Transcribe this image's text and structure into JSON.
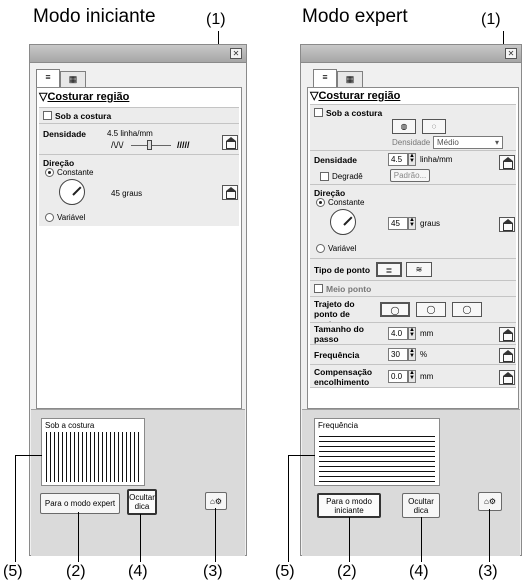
{
  "left": {
    "heading": "Modo iniciante",
    "section_title": "Costurar região",
    "sob_costura": "Sob a costura",
    "densidade_label": "Densidade",
    "densidade_value": "4.5 linha/mm",
    "direcao_label": "Direção",
    "constante": "Constante",
    "angle": "45 graus",
    "variavel": "Variável",
    "preview_caption": "Sob a costura",
    "btn_mode": "Para o modo expert",
    "btn_hint": "Ocultar dica"
  },
  "right": {
    "heading": "Modo expert",
    "section_title": "Costurar região",
    "sob_costura": "Sob a costura",
    "sub_densidade": "Densidade",
    "sub_densidade_value": "Médio",
    "densidade_label": "Densidade",
    "densidade_value": "4.5",
    "densidade_unit": "linha/mm",
    "degrade": "Degradê",
    "padrao": "Padrão...",
    "direcao_label": "Direção",
    "constante": "Constante",
    "angle_value": "45",
    "angle_unit": "graus",
    "variavel": "Variável",
    "tipo_ponto": "Tipo de ponto",
    "meio_ponto": "Meio ponto",
    "trajeto": "Trajeto do ponto de costura",
    "tamanho_label": "Tamanho do passo",
    "tamanho_value": "4.0",
    "tamanho_unit": "mm",
    "frequencia_label": "Frequência",
    "frequencia_value": "30",
    "frequencia_unit": "%",
    "compensacao_label": "Compensação encolhimento",
    "compensacao_value": "0.0",
    "compensacao_unit": "mm",
    "preview_caption": "Frequência",
    "btn_mode": "Para o modo iniciante",
    "btn_hint": "Ocultar dica"
  },
  "callouts": {
    "c1": "(1)",
    "c2": "(2)",
    "c3": "(3)",
    "c4": "(4)",
    "c5": "(5)"
  }
}
